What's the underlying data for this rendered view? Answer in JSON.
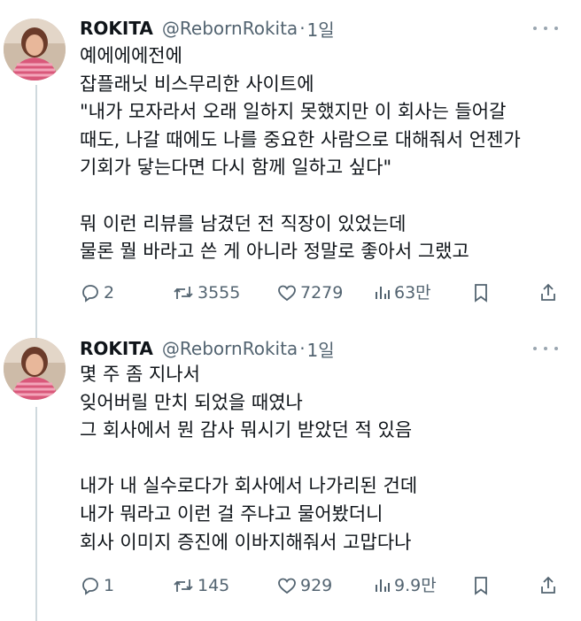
{
  "tweets": [
    {
      "name": "ROKITA",
      "handle": "@RebornRokita",
      "dot": "·",
      "time": "1일",
      "lines": [
        "예에에에전에",
        "잡플래닛 비스무리한 사이트에",
        "\"내가 모자라서 오래 일하지 못했지만 이 회사는 들어갈",
        "때도, 나갈 때에도 나를 중요한 사람으로 대해줘서 언젠가",
        "기회가 닿는다면 다시 함께 일하고 싶다\"",
        "",
        "뭐 이런 리뷰를 남겼던 전 직장이 있었는데",
        "물론 뭘 바라고 쓴 게 아니라 정말로 좋아서 그랬고"
      ],
      "replies": "2",
      "retweets": "3555",
      "likes": "7279",
      "views": "63만"
    },
    {
      "name": "ROKITA",
      "handle": "@RebornRokita",
      "dot": "·",
      "time": "1일",
      "lines": [
        "몇 주 좀 지나서",
        "잊어버릴 만치 되었을 때였나",
        "그 회사에서 뭔 감사 뭐시기 받았던 적 있음",
        "",
        "내가 내 실수로다가 회사에서 나가리된 건데",
        "내가 뭐라고 이런 걸 주냐고 물어봤더니",
        "회사 이미지 증진에 이바지해줘서 고맙다나"
      ],
      "replies": "1",
      "retweets": "145",
      "likes": "929",
      "views": "9.9만"
    }
  ],
  "icons": {
    "reply": "reply-icon",
    "retweet": "retweet-icon",
    "like": "heart-icon",
    "views": "views-chart-icon",
    "bookmark": "bookmark-icon",
    "share": "share-icon",
    "more": "more-icon"
  },
  "colors": {
    "text": "#0f1419",
    "muted": "#536471",
    "thread_line": "#cfd9de"
  }
}
